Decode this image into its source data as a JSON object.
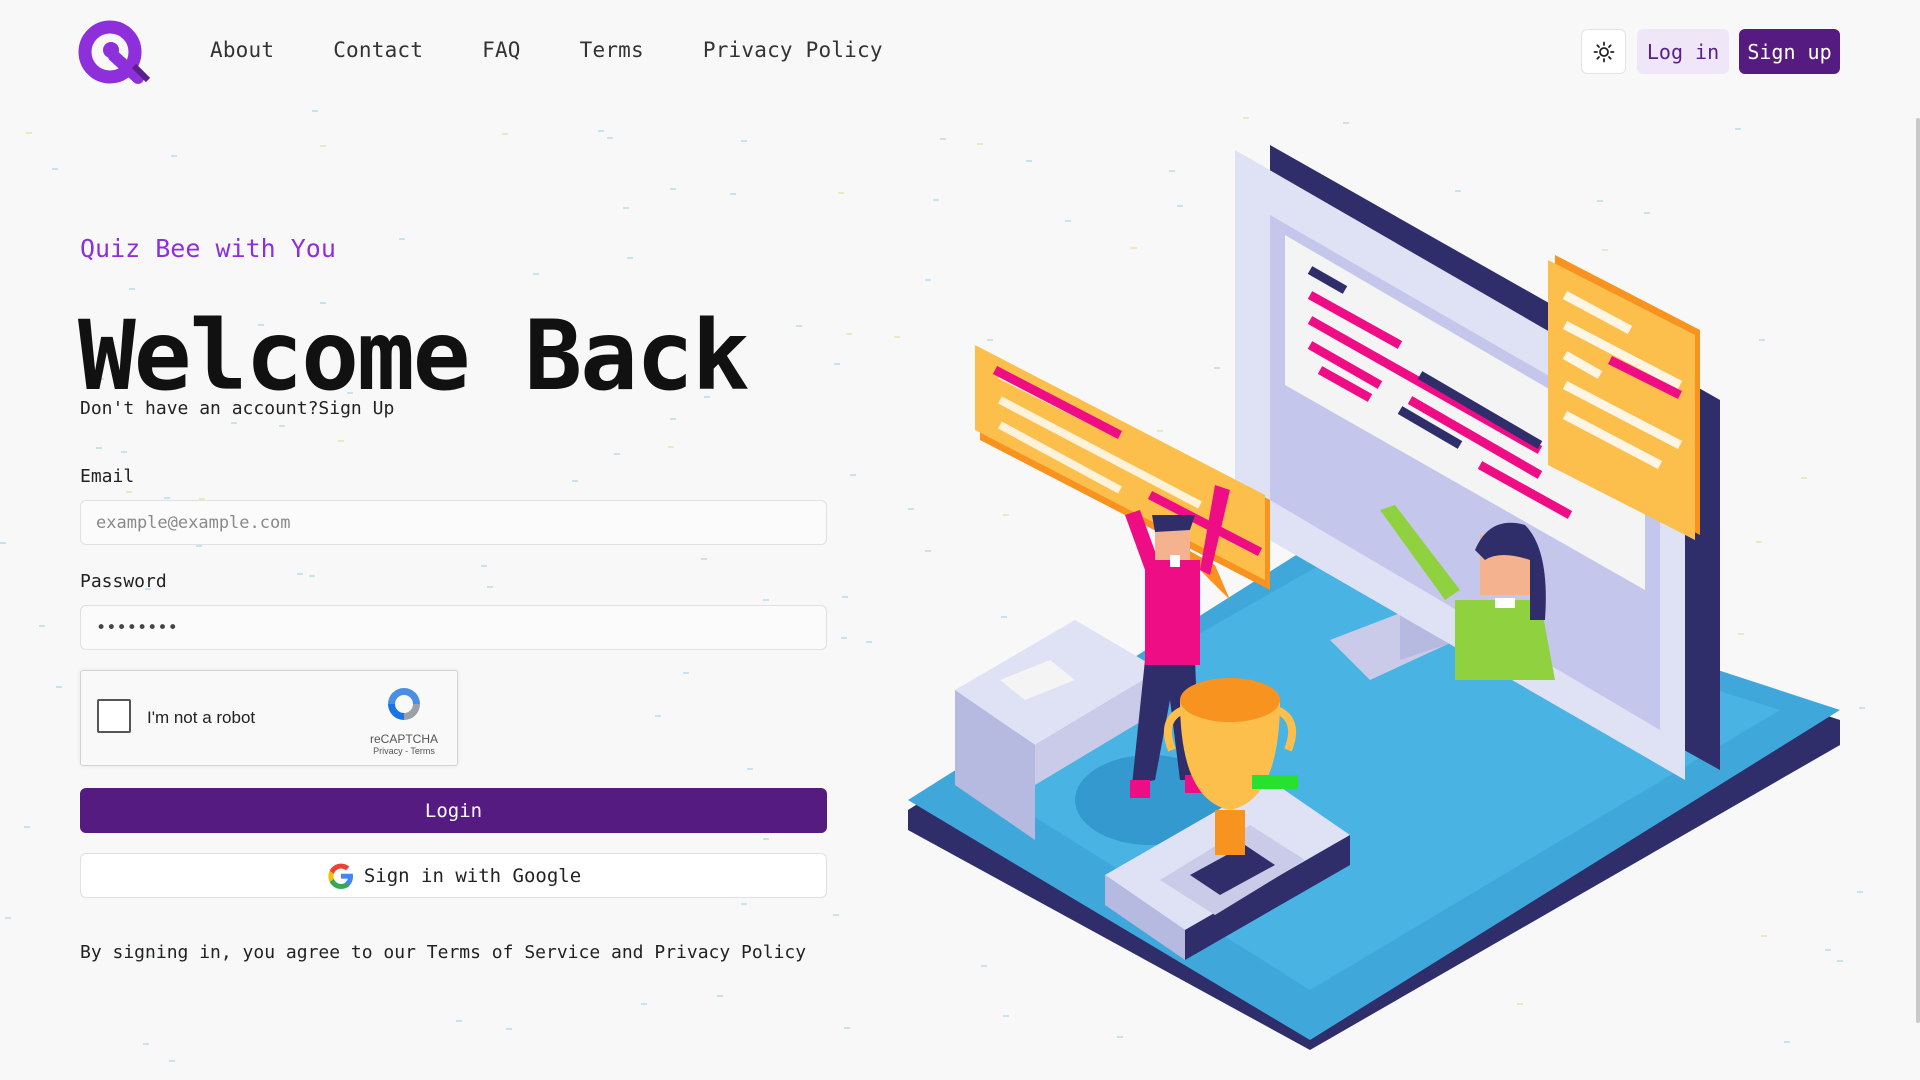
{
  "header": {
    "logo_alt": "Quiz Bee logo",
    "nav": [
      "About",
      "Contact",
      "FAQ",
      "Terms",
      "Privacy Policy"
    ],
    "theme_icon": "sun-icon",
    "login_label": "Log in",
    "signup_label": "Sign up"
  },
  "form": {
    "tagline": "Quiz Bee with You",
    "title": "Welcome Back",
    "subline_text": "Don't have an account?",
    "subline_link": "Sign Up",
    "email_label": "Email",
    "email_placeholder": "example@example.com",
    "password_label": "Password",
    "password_value": "••••••••",
    "captcha_text": "I'm not a robot",
    "captcha_brand": "reCAPTCHA",
    "captcha_links": "Privacy - Terms",
    "login_button": "Login",
    "google_button": "Sign in with Google",
    "disclaimer": "By signing in, you agree to our Terms of Service and Privacy Policy"
  },
  "colors": {
    "brand": "#561b80",
    "accent": "#8e2fdc",
    "illustration_base": "#3fa7da",
    "illustration_pink": "#ef0d86",
    "illustration_orange": "#fdbf4c"
  }
}
